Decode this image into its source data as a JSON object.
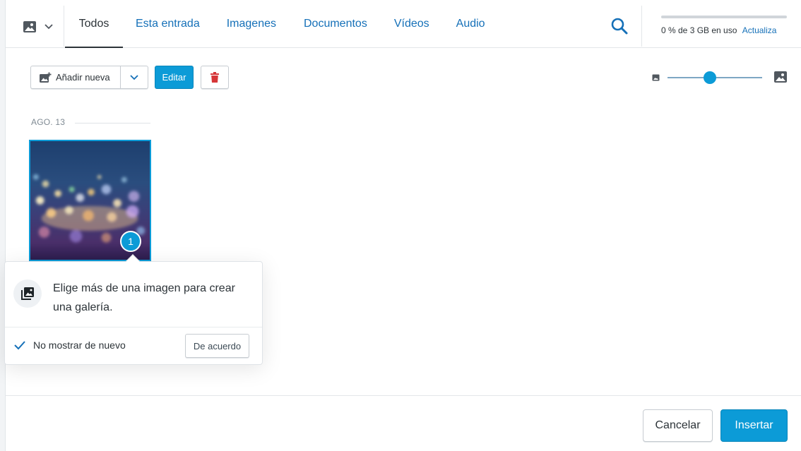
{
  "colors": {
    "accent": "#0c9bd7",
    "link": "#1570b8",
    "delete": "#d63638",
    "text": "#2c3338"
  },
  "header": {
    "type_picker_icon": "image-icon",
    "tabs": [
      {
        "label": "Todos",
        "active": true
      },
      {
        "label": "Esta entrada"
      },
      {
        "label": "Imagenes"
      },
      {
        "label": "Documentos"
      },
      {
        "label": "Vídeos"
      },
      {
        "label": "Audio"
      }
    ],
    "search_icon": "search-icon",
    "storage": {
      "used_percent": 0,
      "used_text": "0 % de 3 GB en uso",
      "upgrade_label": "Actualiza"
    }
  },
  "toolbar": {
    "add_new_label": "Añadir nueva",
    "edit_label": "Editar",
    "delete_icon": "trash-icon",
    "zoom_level": 0.45
  },
  "library": {
    "date_group": "AGO. 13",
    "items": [
      {
        "selected_order": "1"
      }
    ]
  },
  "popover": {
    "message": "Elige más de una imagen para crear una galería.",
    "dont_show_label": "No mostrar de nuevo",
    "dont_show_checked": true,
    "ok_label": "De acuerdo"
  },
  "footer": {
    "cancel_label": "Cancelar",
    "insert_label": "Insertar"
  }
}
